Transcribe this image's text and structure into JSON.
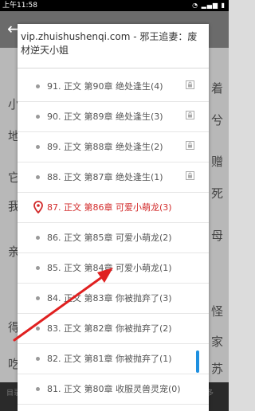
{
  "status_bar": {
    "time": "上午11:58",
    "icons": "◔ ▂▄▆ ▮"
  },
  "background": {
    "lines": [
      {
        "text": "着",
        "side": "right"
      },
      {
        "text": "小",
        "side": "left"
      },
      {
        "text": "兮",
        "side": "right"
      },
      {
        "text": "地",
        "side": "left"
      },
      {
        "text": "赠",
        "side": "right"
      },
      {
        "text": "它",
        "side": "left"
      },
      {
        "text": "死",
        "side": "right"
      },
      {
        "text": "我",
        "side": "left"
      },
      {
        "text": "母",
        "side": "right"
      },
      {
        "text": "亲",
        "side": "left"
      },
      {
        "text": "怪",
        "side": "right"
      },
      {
        "text": "得",
        "side": "left"
      },
      {
        "text": "家",
        "side": "right"
      },
      {
        "text": "吃",
        "side": "left"
      },
      {
        "text": "苏",
        "side": "right"
      }
    ],
    "bottom_labels": [
      "目录",
      "进度",
      "设置",
      "夜间",
      "更多"
    ]
  },
  "modal": {
    "title": "vip.zhuishushenqi.com - 邪王追妻：废材逆天小姐",
    "chapters": [
      {
        "label": "91. 正文 第90章 绝处逢生(4)",
        "locked": true,
        "current": false
      },
      {
        "label": "90. 正文 第89章 绝处逢生(3)",
        "locked": true,
        "current": false
      },
      {
        "label": "89. 正文 第88章 绝处逢生(2)",
        "locked": true,
        "current": false
      },
      {
        "label": "88. 正文 第87章 绝处逢生(1)",
        "locked": true,
        "current": false
      },
      {
        "label": "87. 正文 第86章 可爱小萌龙(3)",
        "locked": false,
        "current": true
      },
      {
        "label": "86. 正文 第85章 可爱小萌龙(2)",
        "locked": false,
        "current": false
      },
      {
        "label": "85. 正文 第84章 可爱小萌龙(1)",
        "locked": false,
        "current": false
      },
      {
        "label": "84. 正文 第83章 你被抛弃了(3)",
        "locked": false,
        "current": false
      },
      {
        "label": "83. 正文 第82章 你被抛弃了(2)",
        "locked": false,
        "current": false
      },
      {
        "label": "82. 正文 第81章 你被抛弃了(1)",
        "locked": false,
        "current": false
      },
      {
        "label": "81. 正文 第80章 收服灵兽灵宠(0)",
        "locked": false,
        "current": false
      }
    ]
  },
  "colors": {
    "current_chapter": "#d22a2a",
    "scroll_thumb": "#1e90e0",
    "annotation_arrow": "#e02020"
  }
}
